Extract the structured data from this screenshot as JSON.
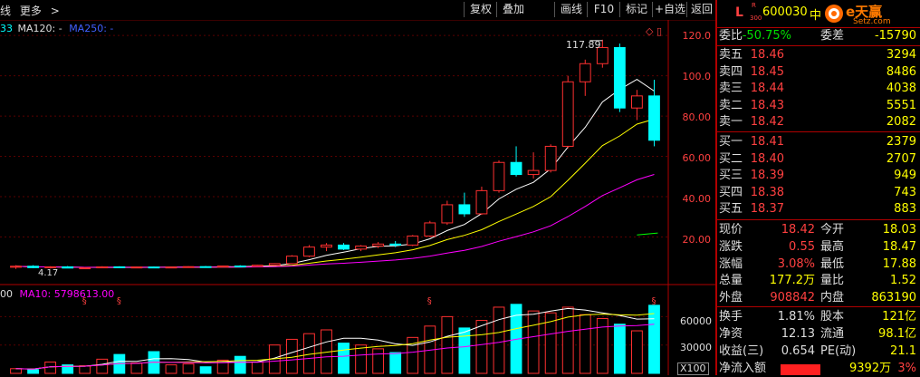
{
  "toolbar": {
    "left_items": [
      "线",
      "更多",
      ">"
    ],
    "buttons": [
      "复权",
      "叠加",
      "画线",
      "F10",
      "标记",
      "+自选",
      "返回"
    ]
  },
  "ma_legend": {
    "prefix": "33",
    "ma120": "MA120: -",
    "ma250": "MA250: -"
  },
  "vol_legend": {
    "prefix": "00",
    "ma10": "MA10: 5798613.00"
  },
  "price_axis": {
    "labels": [
      "120.0",
      "100.0",
      "80.00",
      "60.00",
      "40.00",
      "20.00"
    ],
    "max_label": "117.89",
    "min_label": "4.17"
  },
  "volume_axis": {
    "labels": [
      "60000",
      "30000"
    ],
    "unit": "X100"
  },
  "header": {
    "l_mark": "L",
    "sub_top": "R",
    "sub_bottom": "300",
    "code": "600030",
    "name": "中",
    "logo_text": "e天赢",
    "logo_site": "Setz.com"
  },
  "quote": {
    "weibi_label": "委比",
    "weibi_value": "-50.75%",
    "weicha_label": "委差",
    "weicha_value": "-15790",
    "asks": [
      {
        "label": "卖五",
        "price": "18.46",
        "vol": "3294"
      },
      {
        "label": "卖四",
        "price": "18.45",
        "vol": "8486"
      },
      {
        "label": "卖三",
        "price": "18.44",
        "vol": "4038"
      },
      {
        "label": "卖二",
        "price": "18.43",
        "vol": "5551"
      },
      {
        "label": "卖一",
        "price": "18.42",
        "vol": "2082"
      }
    ],
    "bids": [
      {
        "label": "买一",
        "price": "18.41",
        "vol": "2379"
      },
      {
        "label": "买二",
        "price": "18.40",
        "vol": "2707"
      },
      {
        "label": "买三",
        "price": "18.39",
        "vol": "949"
      },
      {
        "label": "买四",
        "price": "18.38",
        "vol": "743"
      },
      {
        "label": "买五",
        "price": "18.37",
        "vol": "883"
      }
    ],
    "stats": [
      {
        "l1": "现价",
        "v1": "18.42",
        "l2": "今开",
        "v2": "18.03"
      },
      {
        "l1": "涨跌",
        "v1": "0.55",
        "l2": "最高",
        "v2": "18.47"
      },
      {
        "l1": "涨幅",
        "v1": "3.08%",
        "l2": "最低",
        "v2": "17.88"
      },
      {
        "l1": "总量",
        "v1": "177.2万",
        "l2": "量比",
        "v2": "1.52"
      },
      {
        "l1": "外盘",
        "v1": "908842",
        "l2": "内盘",
        "v2": "863190"
      }
    ],
    "stats2": [
      {
        "l1": "换手",
        "v1": "1.81%",
        "l2": "股本",
        "v2": "121亿"
      },
      {
        "l1": "净资",
        "v1": "12.13",
        "l2": "流通",
        "v2": "98.1亿"
      },
      {
        "l1": "收益(三)",
        "v1": "0.654",
        "l2": "PE(动)",
        "v2": "21.1"
      }
    ],
    "net_inflow_label": "净流入额",
    "net_inflow_value": "9392万",
    "net_inflow_pct": "3%"
  },
  "colors": {
    "up": "#ff3030",
    "down": "#00ffff",
    "ma5": "#ffffff",
    "ma10": "#ffff00",
    "ma20": "#ff00ff",
    "ma60": "#00ff00"
  },
  "chart_data": {
    "type": "candlestick",
    "ylim": [
      0,
      125
    ],
    "candles": [
      {
        "o": 5,
        "h": 6,
        "l": 4.17,
        "c": 5.5,
        "v": 5000
      },
      {
        "o": 5.5,
        "h": 6,
        "l": 4.5,
        "c": 4.8,
        "v": 4000
      },
      {
        "o": 4.8,
        "h": 5.5,
        "l": 4.4,
        "c": 5.2,
        "v": 12000
      },
      {
        "o": 5.2,
        "h": 5.6,
        "l": 4.5,
        "c": 4.6,
        "v": 9000
      },
      {
        "o": 4.6,
        "h": 5,
        "l": 4.2,
        "c": 4.7,
        "v": 8000
      },
      {
        "o": 4.7,
        "h": 5.5,
        "l": 4.5,
        "c": 5.2,
        "v": 15000
      },
      {
        "o": 5.2,
        "h": 5.5,
        "l": 4.6,
        "c": 4.8,
        "v": 20000
      },
      {
        "o": 4.8,
        "h": 5.3,
        "l": 4.5,
        "c": 5.1,
        "v": 11000
      },
      {
        "o": 5.1,
        "h": 5.4,
        "l": 4.7,
        "c": 4.9,
        "v": 23000
      },
      {
        "o": 4.9,
        "h": 5.2,
        "l": 4.6,
        "c": 5.1,
        "v": 9000
      },
      {
        "o": 5.1,
        "h": 5.5,
        "l": 4.8,
        "c": 5.3,
        "v": 10000
      },
      {
        "o": 5.3,
        "h": 5.6,
        "l": 5,
        "c": 5.1,
        "v": 7000
      },
      {
        "o": 5.1,
        "h": 5.8,
        "l": 5,
        "c": 5.6,
        "v": 14000
      },
      {
        "o": 5.6,
        "h": 6,
        "l": 5.2,
        "c": 5.4,
        "v": 18000
      },
      {
        "o": 5.4,
        "h": 6.2,
        "l": 5.3,
        "c": 6,
        "v": 12000
      },
      {
        "o": 6,
        "h": 7,
        "l": 5.8,
        "c": 6.8,
        "v": 30000
      },
      {
        "o": 6.8,
        "h": 11,
        "l": 6.5,
        "c": 10.5,
        "v": 36000
      },
      {
        "o": 10.5,
        "h": 16,
        "l": 10,
        "c": 15,
        "v": 42000
      },
      {
        "o": 15,
        "h": 17,
        "l": 13,
        "c": 16,
        "v": 46000
      },
      {
        "o": 16,
        "h": 17,
        "l": 13.5,
        "c": 14,
        "v": 32000
      },
      {
        "o": 14,
        "h": 16,
        "l": 13,
        "c": 15.5,
        "v": 30000
      },
      {
        "o": 15.5,
        "h": 17.5,
        "l": 14.5,
        "c": 16.5,
        "v": 26000
      },
      {
        "o": 16.5,
        "h": 18,
        "l": 15,
        "c": 16,
        "v": 22000
      },
      {
        "o": 16,
        "h": 21,
        "l": 15.5,
        "c": 20.5,
        "v": 38000
      },
      {
        "o": 20.5,
        "h": 28,
        "l": 20,
        "c": 27,
        "v": 50000
      },
      {
        "o": 27,
        "h": 38,
        "l": 26,
        "c": 36,
        "v": 60000
      },
      {
        "o": 36,
        "h": 42,
        "l": 30,
        "c": 31.5,
        "v": 48000
      },
      {
        "o": 31.5,
        "h": 45,
        "l": 31,
        "c": 43,
        "v": 56000
      },
      {
        "o": 43,
        "h": 58,
        "l": 42,
        "c": 57,
        "v": 70000
      },
      {
        "o": 57,
        "h": 65,
        "l": 50,
        "c": 51,
        "v": 73000
      },
      {
        "o": 51,
        "h": 62,
        "l": 49,
        "c": 53,
        "v": 66000
      },
      {
        "o": 53,
        "h": 66,
        "l": 52,
        "c": 65,
        "v": 64000
      },
      {
        "o": 65,
        "h": 100,
        "l": 64,
        "c": 97,
        "v": 70000
      },
      {
        "o": 97,
        "h": 108,
        "l": 90,
        "c": 106,
        "v": 62000
      },
      {
        "o": 106,
        "h": 117.89,
        "l": 104,
        "c": 114,
        "v": 58000
      },
      {
        "o": 114,
        "h": 116,
        "l": 82,
        "c": 84,
        "v": 52000
      },
      {
        "o": 84,
        "h": 93,
        "l": 78,
        "c": 90,
        "v": 45000
      },
      {
        "o": 90,
        "h": 98,
        "l": 65,
        "c": 68,
        "v": 72000
      }
    ]
  }
}
